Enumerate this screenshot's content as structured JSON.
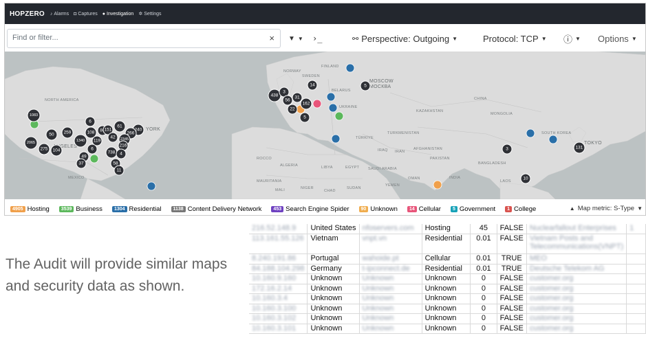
{
  "app": {
    "brand": "HOPZERO",
    "nav": [
      {
        "label": "Alarms",
        "icon": "bell-icon",
        "glyph": "♪"
      },
      {
        "label": "Captures",
        "icon": "camera-icon",
        "glyph": "◘"
      },
      {
        "label": "Investigation",
        "icon": "location-pin-icon",
        "glyph": "●"
      },
      {
        "label": "Settings",
        "icon": "gear-icon",
        "glyph": "✲"
      }
    ]
  },
  "toolbar": {
    "search_placeholder": "Find or filter...",
    "clear_glyph": "×",
    "filter_glyph": "▼",
    "terminal_glyph": "›_",
    "perspective_label": "Perspective: Outgoing",
    "protocol_label": "Protocol: TCP",
    "info_glyph": "ⓘ",
    "options_label": "Options"
  },
  "map": {
    "labels": {
      "north_america": "NORTH AMERICA",
      "moscow": "MOSCOW",
      "moscow_ru": "МОСКВА",
      "kazakhstan": "KAZAKHSTAN",
      "mongolia": "MONGOLIA",
      "china": "CHINA",
      "india": "INDIA",
      "ukraine": "UKRAINE",
      "belarus": "BELARUS",
      "turkiye": "TÜRKİYE",
      "iran": "IRAN",
      "iraq": "IRAQ",
      "egypt": "EGYPT",
      "libya": "LIBYA",
      "algeria": "ALGERIA",
      "saudi_arabia": "SAUDI ARABIA",
      "afghanistan": "AFGHANISTAN",
      "pakistan": "PAKISTAN",
      "turkmenistan": "TURKMENISTAN",
      "mauritania": "MAURITANIA",
      "mali": "MALI",
      "niger": "NIGER",
      "chad": "CHAD",
      "sudan": "SUDAN",
      "oman": "OMAN",
      "yemen": "YEMEN",
      "bangladesh": "BANGLADESH",
      "laos": "LAOS",
      "tokyo": "TOKYO",
      "south_korea": "SOUTH KOREA",
      "mexico": "MEXICO",
      "york": "YORK",
      "angeles": "ANGELES",
      "rocco": "ROCCO",
      "finland": "FINLAND",
      "norway": "NORWAY",
      "sweden": "SWEDEN"
    },
    "clusters": [
      {
        "n": "1083"
      },
      {
        "n": "50"
      },
      {
        "n": "259"
      },
      {
        "n": "2065"
      },
      {
        "n": "275"
      },
      {
        "n": "104"
      },
      {
        "n": "1340"
      },
      {
        "n": "6"
      },
      {
        "n": "108"
      },
      {
        "n": "84"
      },
      {
        "n": "151"
      },
      {
        "n": "61"
      },
      {
        "n": "240"
      },
      {
        "n": "119"
      },
      {
        "n": "42"
      },
      {
        "n": "266"
      },
      {
        "n": "2345"
      },
      {
        "n": "216"
      },
      {
        "n": "6"
      },
      {
        "n": "49"
      },
      {
        "n": "37"
      },
      {
        "n": "738"
      },
      {
        "n": "4"
      },
      {
        "n": "58"
      },
      {
        "n": "11"
      },
      {
        "n": "438"
      },
      {
        "n": "3"
      },
      {
        "n": "56"
      },
      {
        "n": "31"
      },
      {
        "n": "162"
      },
      {
        "n": "22"
      },
      {
        "n": "5"
      },
      {
        "n": "14"
      },
      {
        "n": "5"
      },
      {
        "n": "3"
      },
      {
        "n": "10"
      },
      {
        "n": "131"
      }
    ]
  },
  "legend": [
    {
      "count": "4905",
      "label": "Hosting",
      "color": "#f0a04b"
    },
    {
      "count": "3539",
      "label": "Business",
      "color": "#5cb85c"
    },
    {
      "count": "1304",
      "label": "Residential",
      "color": "#2a6fa8"
    },
    {
      "count": "1138",
      "label": "Content Delivery Network",
      "color": "#777777"
    },
    {
      "count": "453",
      "label": "Search Engine Spider",
      "color": "#6f42c1"
    },
    {
      "count": "90",
      "label": "Unknown",
      "color": "#f0ad4e"
    },
    {
      "count": "14",
      "label": "Cellular",
      "color": "#e8557a"
    },
    {
      "count": "5",
      "label": "Government",
      "color": "#17a2b8"
    },
    {
      "count": "1",
      "label": "College",
      "color": "#d9534f"
    }
  ],
  "map_metric": {
    "icon": "map-metric-icon",
    "glyph": "▲",
    "label": "Map metric: S-Type"
  },
  "caption": "The Audit will provide similar maps and security data as shown.",
  "audit_table": {
    "rows": [
      {
        "ip": "216.52.148.9",
        "country": "United States",
        "domain": "nfoservers.com",
        "type": "Hosting",
        "score": "45",
        "flag": "FALSE",
        "org": "Nuclearfallout Enterprises",
        "extra": "1"
      },
      {
        "ip": "113.161.55.126",
        "country": "Vietnam",
        "domain": "vnpt.vn",
        "type": "Residential",
        "score": "0.01",
        "flag": "FALSE",
        "org": "Vietnam Posts and Telecommunications(VNPT)",
        "extra": ""
      },
      {
        "ip": "8.240.191.86",
        "country": "Portugal",
        "domain": "wahoide.pt",
        "type": "Cellular",
        "score": "0.01",
        "flag": "TRUE",
        "org": "MEO",
        "extra": ""
      },
      {
        "ip": "84.188.104.298",
        "country": "Germany",
        "domain": "t-ipconnect.de",
        "type": "Residential",
        "score": "0.01",
        "flag": "TRUE",
        "org": "Deutsche Telekom AG",
        "extra": ""
      },
      {
        "ip": "10.160.9.160",
        "country": "Unknown",
        "domain": "Unknown",
        "type": "Unknown",
        "score": "0",
        "flag": "FALSE",
        "org": "customer.org",
        "extra": ""
      },
      {
        "ip": "172.16.2.14",
        "country": "Unknown",
        "domain": "Unknown",
        "type": "Unknown",
        "score": "0",
        "flag": "FALSE",
        "org": "customer.org",
        "extra": ""
      },
      {
        "ip": "10.160.3.4",
        "country": "Unknown",
        "domain": "Unknown",
        "type": "Unknown",
        "score": "0",
        "flag": "FALSE",
        "org": "customer.org",
        "extra": ""
      },
      {
        "ip": "10.160.3.100",
        "country": "Unknown",
        "domain": "Unknown",
        "type": "Unknown",
        "score": "0",
        "flag": "FALSE",
        "org": "customer.org",
        "extra": ""
      },
      {
        "ip": "10.160.3.102",
        "country": "Unknown",
        "domain": "Unknown",
        "type": "Unknown",
        "score": "0",
        "flag": "FALSE",
        "org": "customer.org",
        "extra": ""
      },
      {
        "ip": "10.160.3.101",
        "country": "Unknown",
        "domain": "Unknown",
        "type": "Unknown",
        "score": "0",
        "flag": "FALSE",
        "org": "customer.org",
        "extra": ""
      }
    ]
  }
}
